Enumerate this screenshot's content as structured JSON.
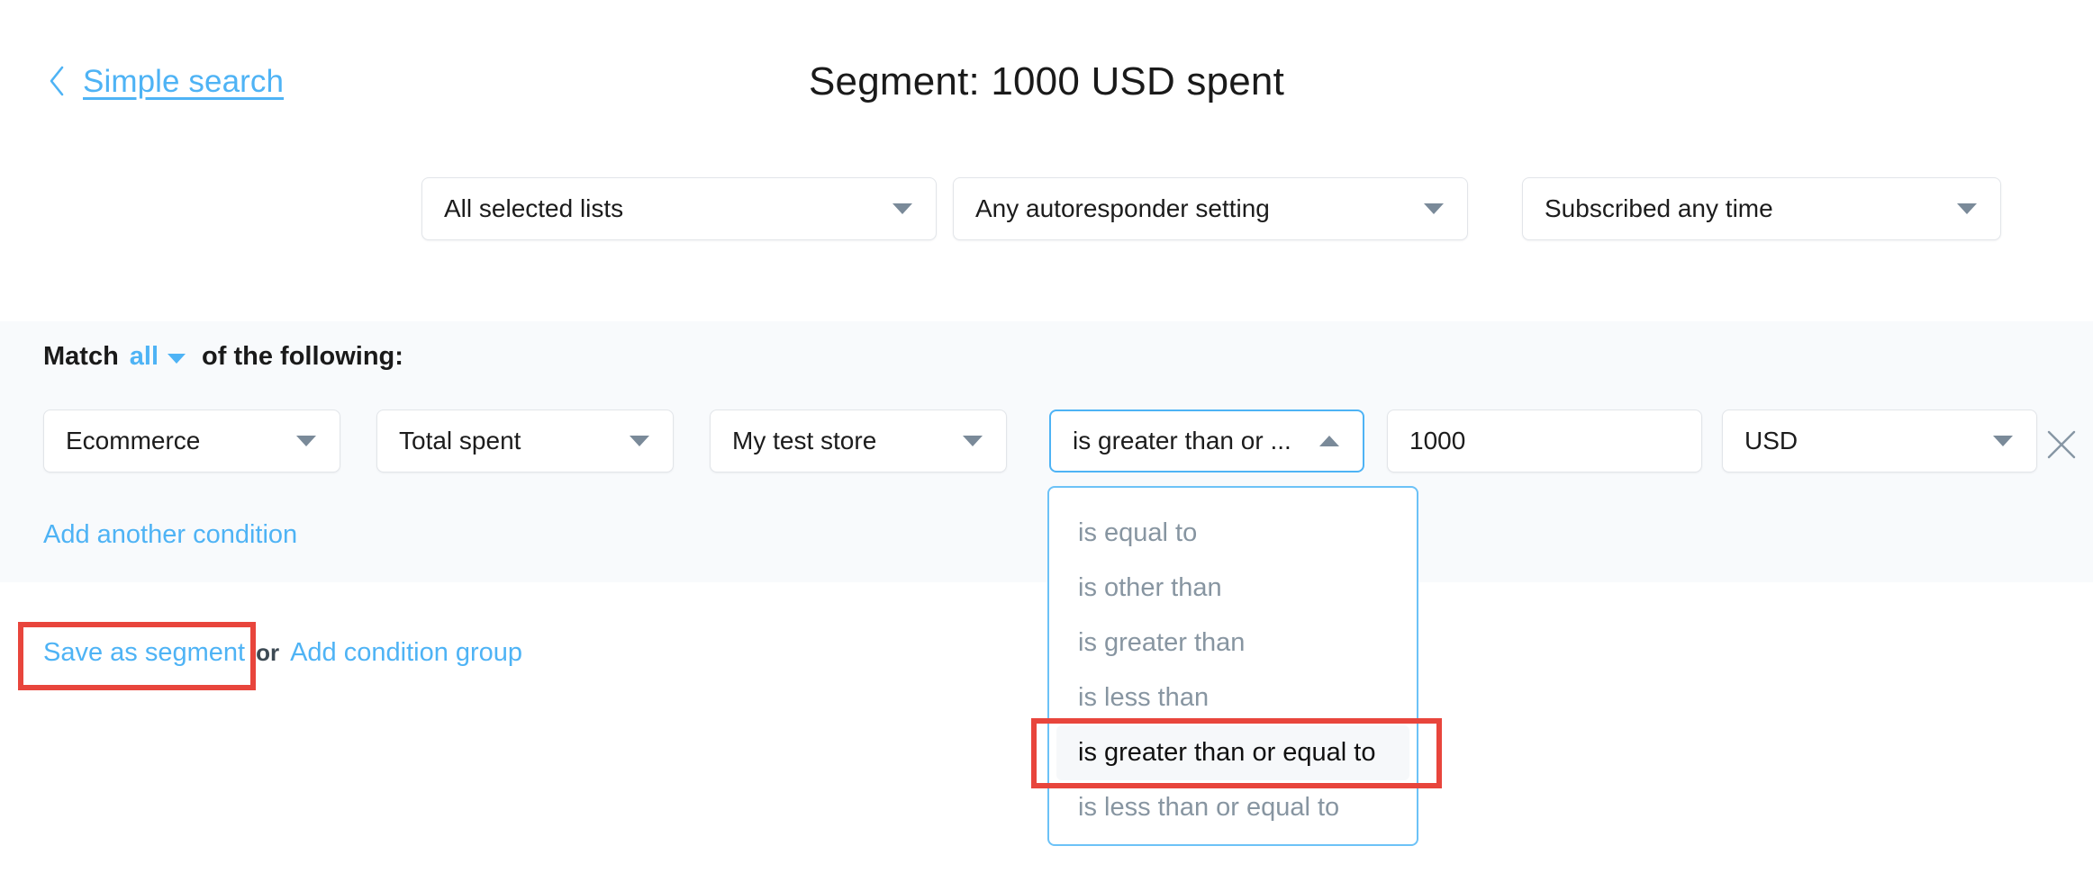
{
  "header": {
    "back_link": "Simple search",
    "back_icon": "chevron-left-icon",
    "title": "Segment: 1000 USD spent"
  },
  "filters": [
    {
      "name": "lists",
      "value": "All selected lists",
      "icon": "chevron-down-icon"
    },
    {
      "name": "autoresponder",
      "value": "Any autoresponder setting",
      "icon": "chevron-down-icon"
    },
    {
      "name": "subscribed",
      "value": "Subscribed any time",
      "icon": "chevron-down-icon"
    }
  ],
  "match": {
    "prefix": "Match",
    "mode": "all",
    "suffix": "of the following:",
    "caret_icon": "chevron-down-icon"
  },
  "condition": {
    "type": "Ecommerce",
    "field": "Total spent",
    "store": "My test store",
    "operator": "is greater than or ...",
    "operator_caret_icon": "chevron-up-icon",
    "value": "1000",
    "currency": "USD",
    "remove_icon": "close-icon"
  },
  "links": {
    "add_condition": "Add another condition",
    "save_as_segment": "Save as segment",
    "or": "or",
    "add_condition_group": "Add condition group"
  },
  "dropdown": {
    "options": [
      {
        "label": "is equal to",
        "selected": false
      },
      {
        "label": "is other than",
        "selected": false
      },
      {
        "label": "is greater than",
        "selected": false
      },
      {
        "label": "is less than",
        "selected": false
      },
      {
        "label": "is greater than or equal to",
        "selected": true
      },
      {
        "label": "is less than or equal to",
        "selected": false
      }
    ]
  },
  "annotations": {
    "color": "#e8453c",
    "boxes": [
      "save-as-segment",
      "is-greater-than-or-equal-to-option"
    ]
  },
  "colors": {
    "link_blue": "#4eb3f5",
    "panel_bg": "#f8fafc",
    "border_grey": "#e2e5e9",
    "option_grey": "#8795a1",
    "focus_blue": "#6cc2f7",
    "annotation_red": "#e8453c"
  }
}
